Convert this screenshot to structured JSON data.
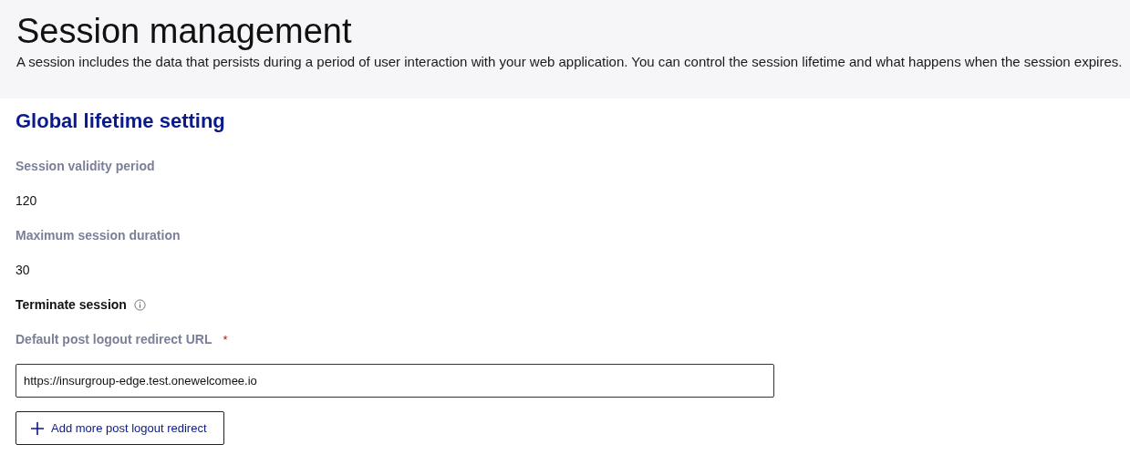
{
  "header": {
    "title": "Session management",
    "description": "A session includes the data that persists during a period of user interaction with your web application. You can control the session lifetime and what happens when the session expires."
  },
  "section": {
    "title": "Global lifetime setting",
    "settings": [
      {
        "kind": "value",
        "label": "Session validity period",
        "value": "120"
      },
      {
        "kind": "value",
        "label": "Maximum session duration",
        "value": "30"
      },
      {
        "kind": "heading",
        "label": "Terminate session",
        "info": true
      },
      {
        "kind": "field",
        "label": "Default post logout redirect URL",
        "required_mark": "*",
        "value": "https://insurgroup-edge.test.onewelcomee.io"
      }
    ],
    "add_button": "Add more post logout redirect"
  }
}
